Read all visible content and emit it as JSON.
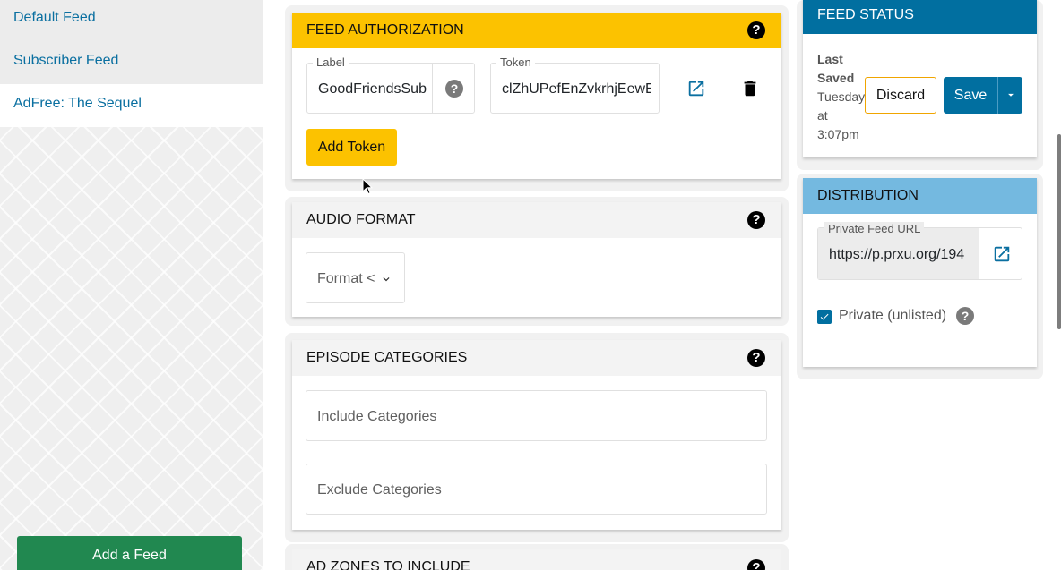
{
  "sidebar": {
    "items": [
      {
        "label": "Default Feed"
      },
      {
        "label": "Subscriber Feed"
      },
      {
        "label": "AdFree: The Sequel"
      }
    ],
    "add_feed_label": "Add a Feed"
  },
  "feed_authorization": {
    "title": "FEED AUTHORIZATION",
    "label_field": {
      "label": "Label",
      "value": "GoodFriendsSub"
    },
    "token_field": {
      "label": "Token",
      "value": "clZhUPefEnZvkrhjEewE"
    },
    "add_token_label": "Add Token"
  },
  "audio_format": {
    "title": "AUDIO FORMAT",
    "format_placeholder": "Format <"
  },
  "episode_categories": {
    "title": "EPISODE CATEGORIES",
    "include_placeholder": "Include Categories",
    "exclude_placeholder": "Exclude Categories"
  },
  "ad_zones": {
    "title": "AD ZONES TO INCLUDE"
  },
  "feed_status": {
    "title": "FEED STATUS",
    "last_saved_label_1": "Last",
    "last_saved_label_2": "Saved",
    "last_saved_value_1": "Tuesday",
    "last_saved_value_2": "at",
    "last_saved_value_3": "3:07pm",
    "discard_label": "Discard",
    "save_label": "Save"
  },
  "distribution": {
    "title": "DISTRIBUTION",
    "private_url_label": "Private Feed URL",
    "private_url_value": "https://p.prxu.org/194",
    "private_checkbox_label": "Private (unlisted)",
    "private_checked": true
  },
  "colors": {
    "brand_blue": "#0a6fa0",
    "status_header": "#016fa0",
    "distribution_header": "#74b9e0",
    "auth_header": "#fcc200",
    "add_feed_green": "#218850"
  },
  "icons": [
    "help-icon",
    "open-external-icon",
    "trash-icon",
    "chevron-down-icon",
    "caret-down-icon",
    "checkbox-checked-icon",
    "mouse-cursor-icon"
  ]
}
